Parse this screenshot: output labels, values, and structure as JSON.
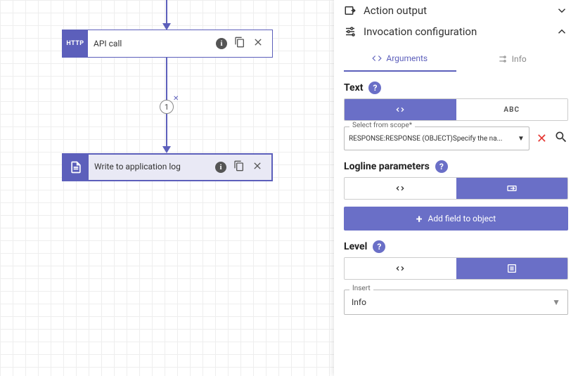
{
  "canvas": {
    "node_api": {
      "badge": "HTTP",
      "label": "API call"
    },
    "node_log": {
      "label": "Write to application log"
    },
    "edge_count": "1"
  },
  "panel": {
    "action_output": "Action output",
    "invocation": "Invocation configuration",
    "tabs": {
      "arguments": "Arguments",
      "info": "Info"
    },
    "text": {
      "label": "Text",
      "abc": "ABC",
      "scope_label": "Select from scope*",
      "scope_value": "RESPONSE:RESPONSE (OBJECT)Specify the na..."
    },
    "logline": {
      "label": "Logline parameters",
      "add": "Add field to object"
    },
    "level": {
      "label": "Level",
      "insert_label": "Insert",
      "insert_value": "Info"
    }
  }
}
